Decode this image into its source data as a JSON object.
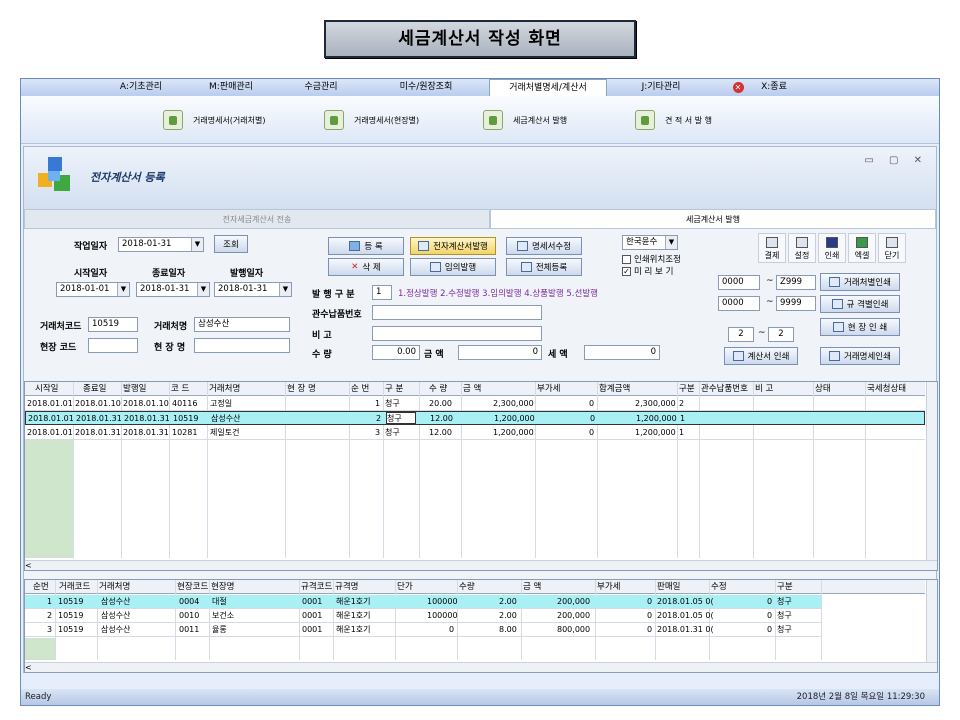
{
  "slide_title": "세금계산서 작성 화면",
  "menu": [
    {
      "label": "A:기초관리"
    },
    {
      "label": "M:판매관리"
    },
    {
      "label": "수금관리"
    },
    {
      "label": "미수/원장조회"
    },
    {
      "label": "거래처별명세/계산서"
    },
    {
      "label": "J:기타관리"
    },
    {
      "label": "X:종료"
    }
  ],
  "ribbon": [
    {
      "label": "거래명세서(거래처별)"
    },
    {
      "label": "거래명세서(현장별)"
    },
    {
      "label": "세금계산서 발행"
    },
    {
      "label": "견 적 서 발 행"
    }
  ],
  "window": {
    "title": "전자계산서 등록",
    "controls": "▭ ▢ ✕"
  },
  "tabs": [
    "전자세금계산서 전송",
    "세금계산서 발행"
  ],
  "form": {
    "work_date_label": "작업일자",
    "work_date": "2018-01-31",
    "query_btn": "조회",
    "start_label": "시작일자",
    "end_label": "종료일자",
    "issue_label": "발행일자",
    "start_date": "2018-01-01",
    "end_date": "2018-01-31",
    "issue_date": "2018-01-31",
    "cust_code_label": "거래처코드",
    "cust_code": "10519",
    "cust_name_label": "거래처명",
    "cust_name": "삼성수산",
    "site_code_label": "현장 코드",
    "site_code": "",
    "site_name_label": "현 장 명",
    "site_name": "",
    "btn_register": "등 록",
    "btn_delete": "삭 제",
    "btn_e_issue": "전자계산서발행",
    "btn_voluntary": "임의발행",
    "btn_stmt_edit": "명세서수정",
    "btn_full_reg": "전체등록",
    "issue_type_label": "발 행 구 분",
    "issue_type": "1",
    "issue_type_desc": "1.정상발행 2.수정발행 3.임의발행 4.상품발행 5.선발행",
    "customs_label": "관수납품번호",
    "customs": "",
    "remark_label": "비 고",
    "remark": "",
    "qty_label": "수 량",
    "qty": "0.00",
    "amount_label": "금 액",
    "amount": "0",
    "tax_label": "세 액",
    "tax": "0",
    "currency": "한국윤수",
    "chk_print_pos": "인쇄위치조정",
    "chk_preview": "미 리 보 기",
    "toolbar": [
      "결제",
      "설정",
      "인쇄",
      "엑셀",
      "닫기"
    ],
    "range1_from": "0000",
    "range1_to": "Z999",
    "range2_from": "0000",
    "range2_to": "9999",
    "page_from": "2",
    "page_to": "2",
    "btn_by_cust": "거래처별인쇄",
    "btn_by_spec": "규 격별인쇄",
    "btn_by_site": "현 장 인 쇄",
    "btn_invoice_print": "계산서 인쇄",
    "btn_stmt_print": "거래명세인쇄"
  },
  "grid1": {
    "headers": [
      "시작일",
      "종료일",
      "발행일",
      "코 드",
      "거래처명",
      "현 장 명",
      "순 번",
      "구 분",
      "수 량",
      "금 액",
      "부가세",
      "합계금액",
      "구분",
      "관수납품번호",
      "비 고",
      "상태",
      "국세청상태"
    ],
    "rows": [
      {
        "start": "2018.01.01",
        "end": "2018.01.10",
        "issue": "2018.01.10",
        "code": "40116",
        "name": "고정일",
        "site": "",
        "seq": "1",
        "type": "청구",
        "qty": "20.00",
        "amount": "2,300,000",
        "vat": "0",
        "total": "2,300,000",
        "kind": "2"
      },
      {
        "start": "2018.01.01",
        "end": "2018.01.31",
        "issue": "2018.01.31",
        "code": "10519",
        "name": "삼성수산",
        "site": "",
        "seq": "2",
        "type": "청구",
        "qty": "12.00",
        "amount": "1,200,000",
        "vat": "0",
        "total": "1,200,000",
        "kind": "1"
      },
      {
        "start": "2018.01.01",
        "end": "2018.01.31",
        "issue": "2018.01.31",
        "code": "10281",
        "name": "제일토건",
        "site": "",
        "seq": "3",
        "type": "청구",
        "qty": "12.00",
        "amount": "1,200,000",
        "vat": "0",
        "total": "1,200,000",
        "kind": "1"
      }
    ]
  },
  "grid2": {
    "headers": [
      "순번",
      "거래코드",
      "거래처명",
      "현장코드",
      "현장명",
      "규격코드",
      "규격명",
      "단가",
      "수량",
      "금 액",
      "부가세",
      "판매일",
      "수정",
      "구분"
    ],
    "rows": [
      {
        "seq": "1",
        "code": "10519",
        "name": "삼성수산",
        "site_code": "0004",
        "site": "대절",
        "spec_code": "0001",
        "spec": "해운1호기",
        "price": "100000",
        "qty": "2.00",
        "amount": "200,000",
        "vat": "0",
        "date": "2018.01.05 0(",
        "edit": "0",
        "type": "청구"
      },
      {
        "seq": "2",
        "code": "10519",
        "name": "삼성수산",
        "site_code": "0010",
        "site": "보건소",
        "spec_code": "0001",
        "spec": "해운1호기",
        "price": "100000",
        "qty": "2.00",
        "amount": "200,000",
        "vat": "0",
        "date": "2018.01.05 0(",
        "edit": "0",
        "type": "청구"
      },
      {
        "seq": "3",
        "code": "10519",
        "name": "삼성수산",
        "site_code": "0011",
        "site": "율롱",
        "spec_code": "0001",
        "spec": "해운1호기",
        "price": "0",
        "qty": "8.00",
        "amount": "800,000",
        "vat": "0",
        "date": "2018.01.31 0(",
        "edit": "0",
        "type": "청구"
      }
    ]
  },
  "status": {
    "left": "Ready",
    "right": "2018년 2월 8일 목요일 11:29:30"
  },
  "colors": {
    "accent": "#a9f0f4",
    "yellow_btn": "#f0d46a",
    "green_col": "#cfe6cc",
    "purple_text": "#7a2c9a"
  }
}
